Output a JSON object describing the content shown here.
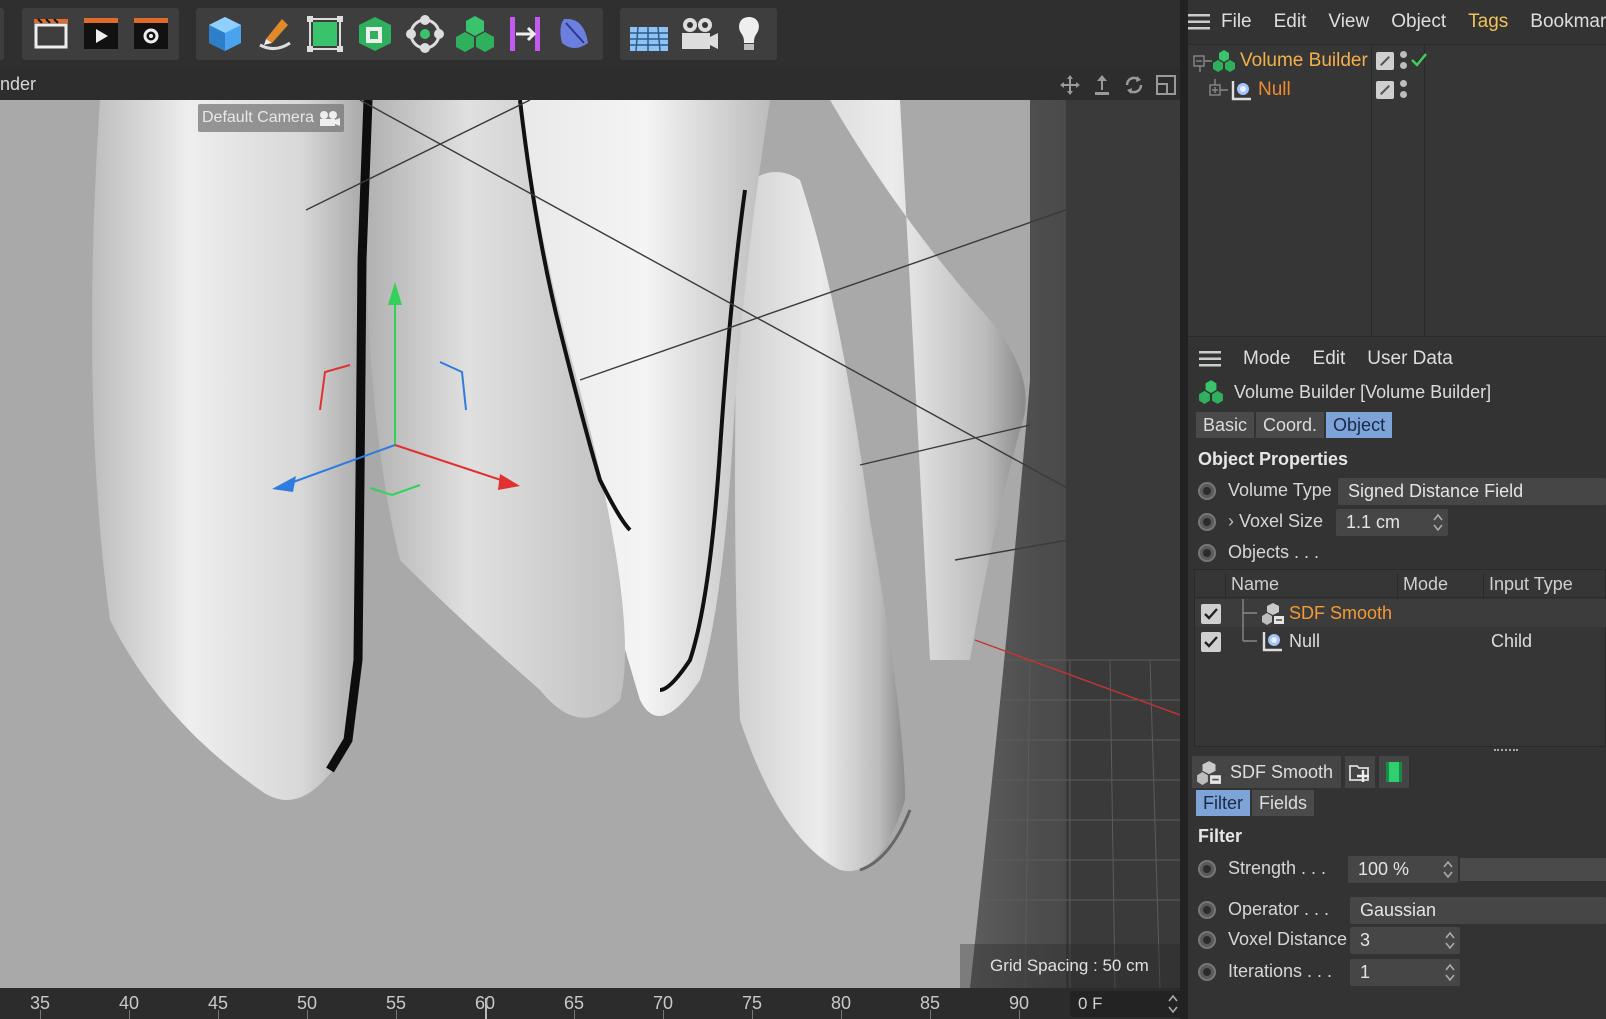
{
  "toolbar": {
    "buttons": [
      "render-region-icon",
      "render-view-icon",
      "render-settings-icon",
      "cube-icon",
      "pen-icon",
      "subdivision-icon",
      "extrude-icon",
      "cloner-icon",
      "volume-builder-icon",
      "symmetry-icon",
      "deformer-icon",
      "floor-icon",
      "camera-icon",
      "light-icon"
    ]
  },
  "viewport": {
    "panel_label": "nder",
    "camera_label": "Default Camera",
    "grid_spacing": "Grid Spacing : 50 cm"
  },
  "timeline": {
    "ticks": [
      "35",
      "40",
      "45",
      "50",
      "55",
      "60",
      "65",
      "70",
      "75",
      "80",
      "85",
      "90"
    ],
    "current_frame": "0 F"
  },
  "object_manager": {
    "menu": [
      "File",
      "Edit",
      "View",
      "Object",
      "Tags",
      "Bookmarks"
    ],
    "objects": [
      {
        "name": "Volume Builder",
        "enabled": true
      },
      {
        "name": "Null",
        "enabled": false
      }
    ]
  },
  "attributes": {
    "menu": [
      "Mode",
      "Edit",
      "User Data"
    ],
    "title": "Volume Builder [Volume Builder]",
    "tabs": [
      "Basic",
      "Coord.",
      "Object"
    ],
    "active_tab": "Object",
    "section": "Object Properties",
    "volume_type_label": "Volume Type",
    "volume_type_value": "Signed Distance Field",
    "voxel_size_label": "Voxel Size",
    "voxel_size_value": "1.1 cm",
    "objects_label": "Objects . . .",
    "list_headers": [
      "Name",
      "Mode",
      "Input Type"
    ],
    "list_rows": [
      {
        "name": "SDF Smooth",
        "mode": "",
        "input_type": "",
        "checked": true
      },
      {
        "name": "Null",
        "mode": "",
        "input_type": "Child",
        "checked": true
      }
    ],
    "sub_object": "SDF Smooth",
    "sub_tabs": [
      "Filter",
      "Fields"
    ],
    "sub_active_tab": "Filter",
    "filter_section": "Filter",
    "strength_label": "Strength . . .",
    "strength_value": "100 %",
    "operator_label": "Operator . . .",
    "operator_value": "Gaussian",
    "voxel_distance_label": "Voxel Distance",
    "voxel_distance_value": "3",
    "iterations_label": "Iterations . . .",
    "iterations_value": "1"
  }
}
